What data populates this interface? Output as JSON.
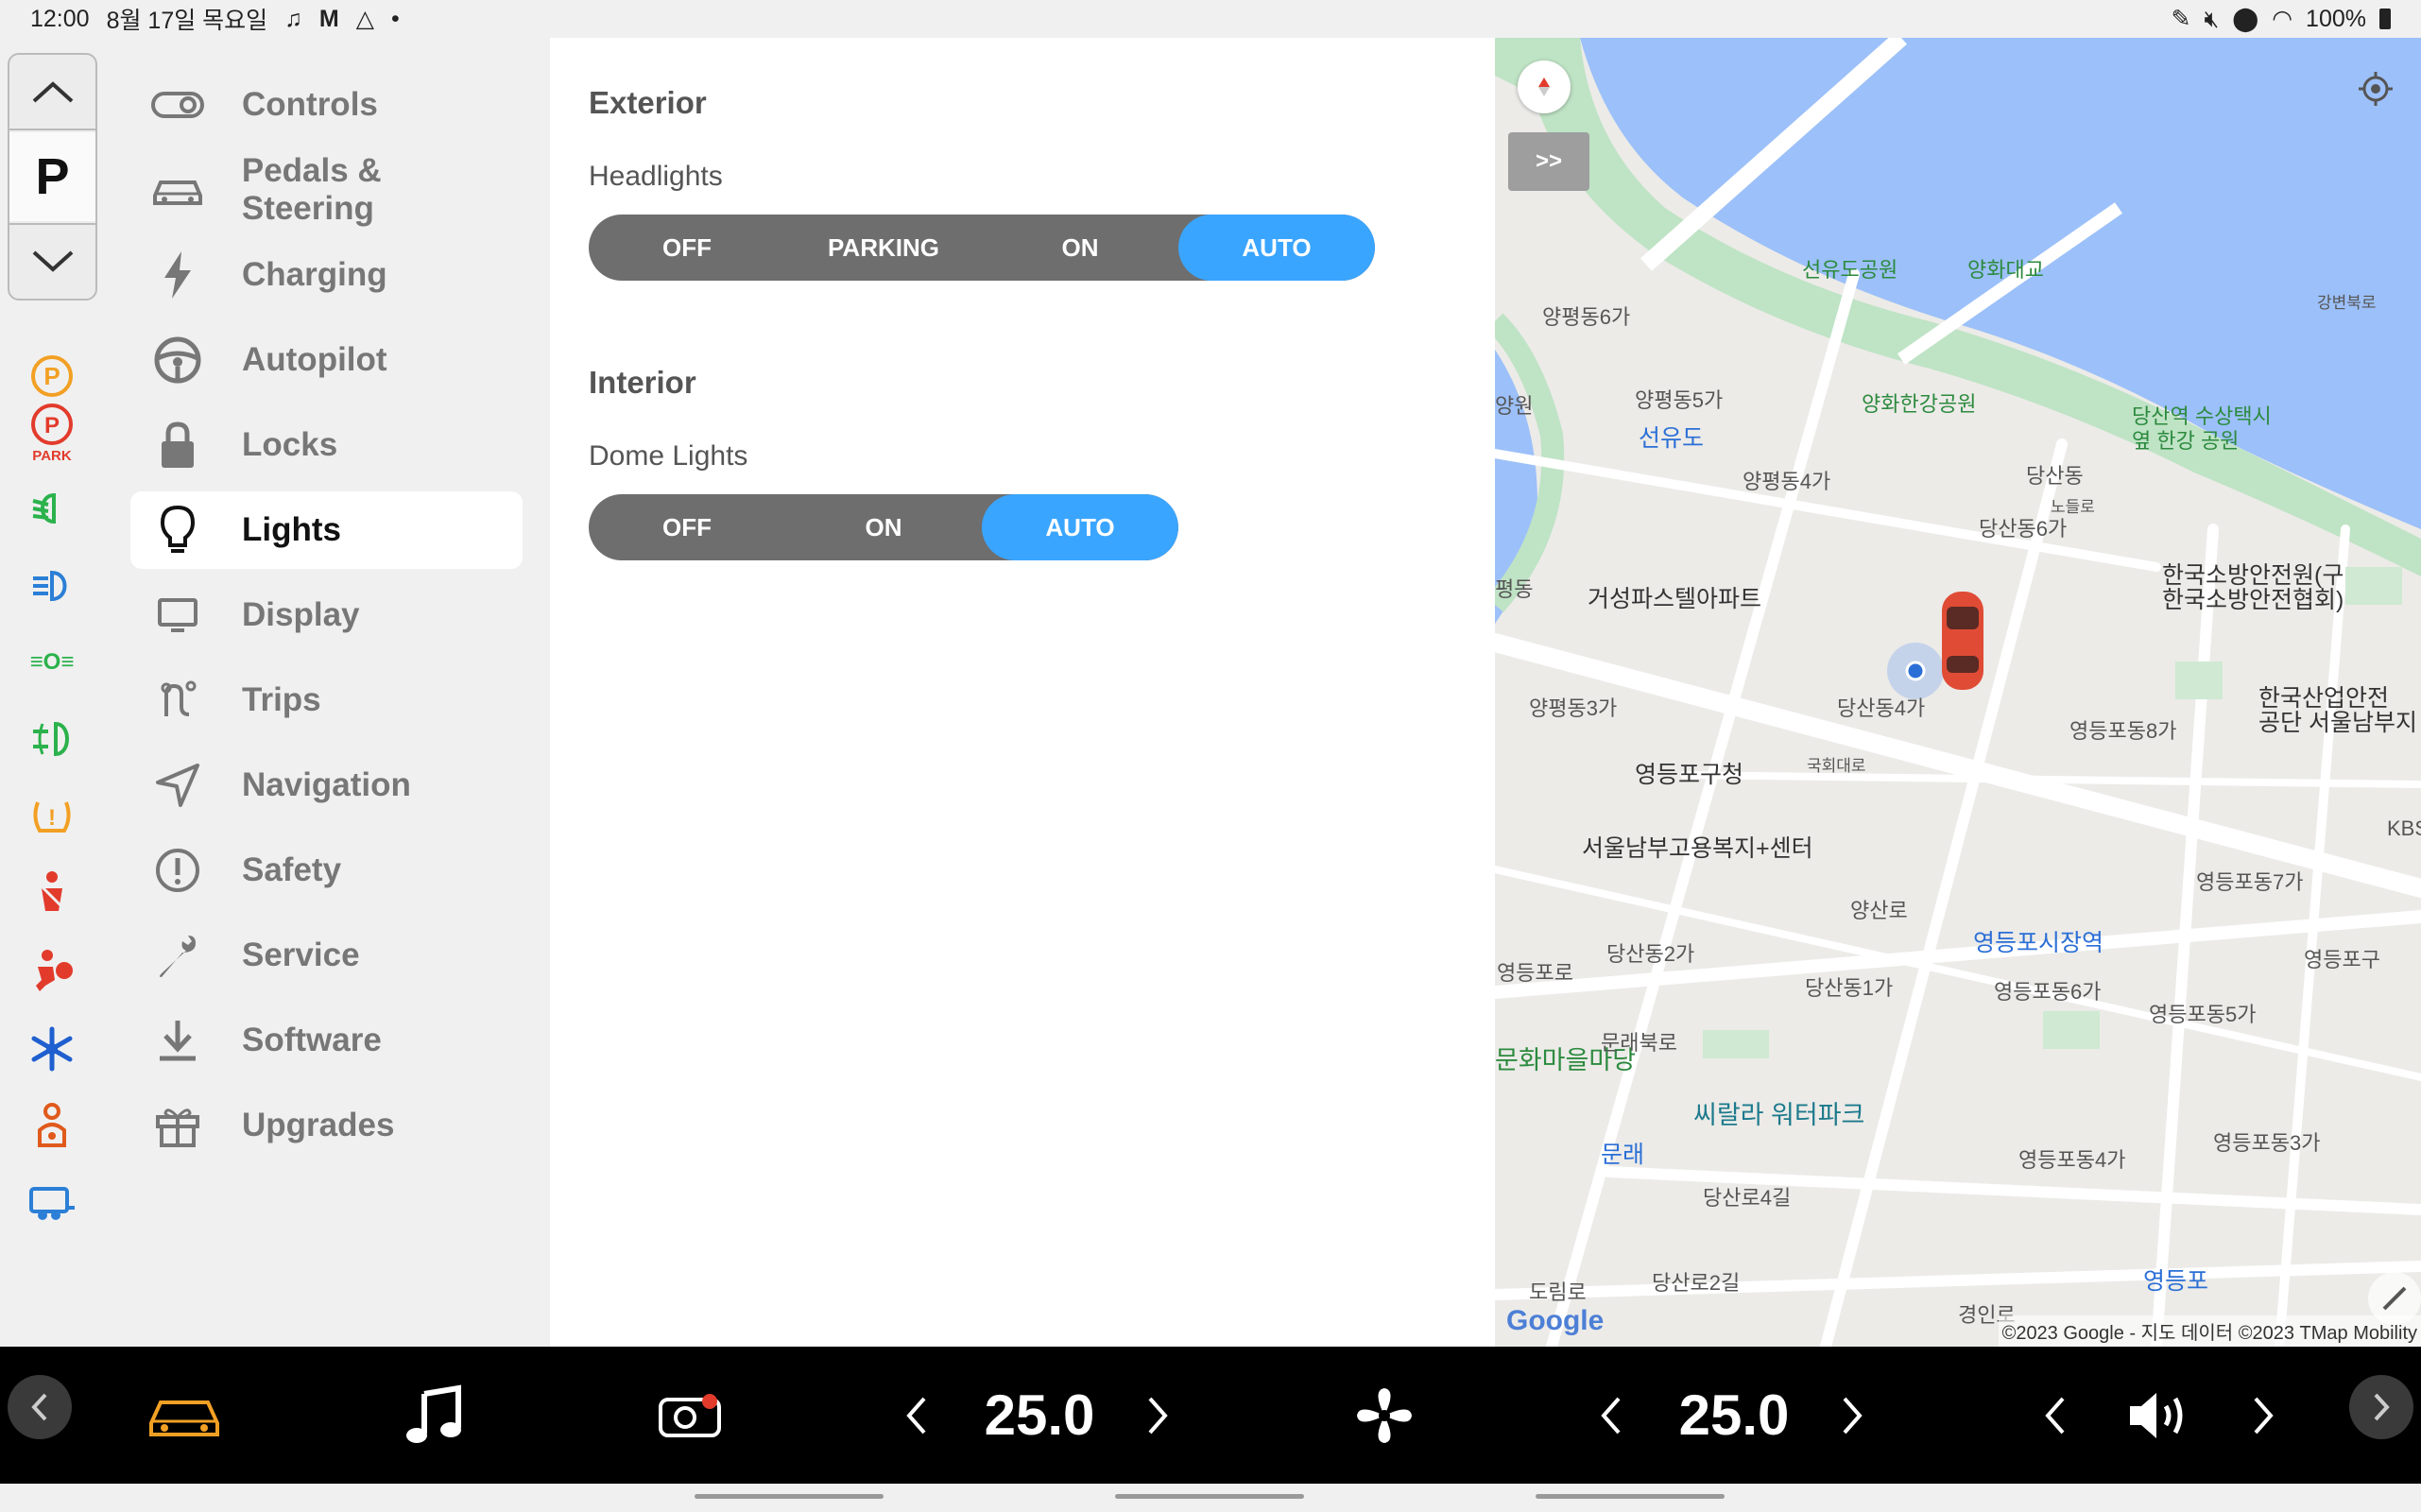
{
  "statusbar": {
    "time": "12:00",
    "date": "8월 17일 목요일",
    "battery": "100%"
  },
  "gear": {
    "current": "P"
  },
  "menu": {
    "items": [
      {
        "label": "Controls",
        "icon": "toggle-icon"
      },
      {
        "label": "Pedals & Steering",
        "icon": "car-icon"
      },
      {
        "label": "Charging",
        "icon": "lightning-icon"
      },
      {
        "label": "Autopilot",
        "icon": "steering-wheel-icon"
      },
      {
        "label": "Locks",
        "icon": "lock-icon"
      },
      {
        "label": "Lights",
        "icon": "lightbulb-icon"
      },
      {
        "label": "Display",
        "icon": "monitor-icon"
      },
      {
        "label": "Trips",
        "icon": "route-icon"
      },
      {
        "label": "Navigation",
        "icon": "navigation-arrow-icon"
      },
      {
        "label": "Safety",
        "icon": "exclamation-circle-icon"
      },
      {
        "label": "Service",
        "icon": "wrench-icon"
      },
      {
        "label": "Software",
        "icon": "download-icon"
      },
      {
        "label": "Upgrades",
        "icon": "gift-icon"
      }
    ],
    "active": "Lights"
  },
  "lights": {
    "exterior_title": "Exterior",
    "headlights_label": "Headlights",
    "headlights_options": [
      "OFF",
      "PARKING",
      "ON",
      "AUTO"
    ],
    "headlights_selected": "AUTO",
    "interior_title": "Interior",
    "dome_label": "Dome Lights",
    "dome_options": [
      "OFF",
      "ON",
      "AUTO"
    ],
    "dome_selected": "AUTO"
  },
  "map": {
    "expand_label": ">>",
    "attribution": "©2023 Google - 지도 데이터 ©2023 TMap Mobility",
    "logo": "Google",
    "labels": {
      "seonyudo_park": "선유도공원",
      "yanghwa_bridge": "양화대교",
      "yanghwa_park": "양화한강공원",
      "dangsan_station_park": "당산역 수상택시\n옆 한강 공원",
      "seonyudo_station": "선유도",
      "geoseong_apt": "거성파스텔아파트",
      "fire_institute": "한국소방안전원(구\n한국소방안전협회)",
      "industrial_safety": "한국산업안전\n공단 서울남부지",
      "ydp_office": "영등포구청",
      "seoul_welfare": "서울남부고용복지+센터",
      "ydp_market": "영등포시장역",
      "culture_madang": "문화마을마당",
      "sillala_waterpark": "씨랄라 워터파크",
      "mullae": "문래",
      "ydp": "영등포",
      "yangpyeong6": "양평동6가",
      "yangpyeong5": "양평동5가",
      "yangpyeong4": "양평동4가",
      "yangpyeong3": "양평동3가",
      "dangsan6": "당산동6가",
      "dangsan4": "당산동4가",
      "dangsan2": "당산동2가",
      "dangsan1": "당산동1가",
      "dangsan": "당산동",
      "ydpdong8": "영등포동8가",
      "ydpdong7": "영등포동7가",
      "ydpdong6": "영등포동6가",
      "ydpdong5": "영등포동5가",
      "ydpdong4": "영등포동4가",
      "ydpdong3": "영등포동3가",
      "ydp_gu": "영등포구",
      "ydp_ro": "영등포로",
      "yangsan_ro": "양산로",
      "mullae_ro": "문래북로",
      "dangsan_ro4": "당산로4길",
      "dangsan_ro2": "당산로2길",
      "gangbyeon": "강변북로",
      "nodeul": "노들로",
      "gyeongin": "경인로",
      "dorim": "도림로",
      "kbs": "KBS",
      "yangwon": "양원",
      "gukhoedaero": "국회대로",
      "pyeongdong": "평동"
    }
  },
  "climate": {
    "left_temp": "25.0",
    "right_temp": "25.0"
  },
  "colors": {
    "accent": "#3aa5ff",
    "segment_bg": "#6e6e6e",
    "warn_orange": "#f2a024",
    "warn_red": "#e23b2c",
    "ok_green": "#2bb24c",
    "info_blue": "#2b7fd6"
  }
}
